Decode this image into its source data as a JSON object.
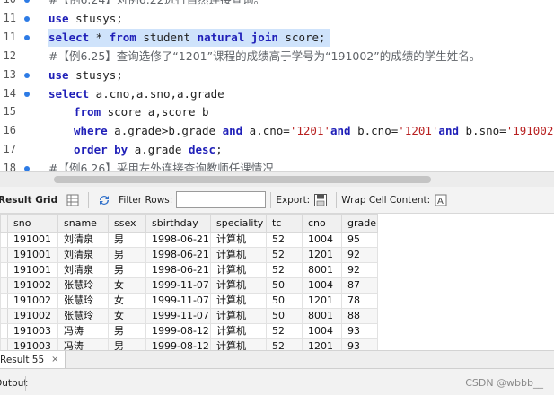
{
  "editor": {
    "lines": [
      {
        "no": "10",
        "bullet": true,
        "segments": [
          {
            "t": "#【例6.24】对例6.22进行自然连接查询。",
            "c": "cmt"
          }
        ]
      },
      {
        "no": "11",
        "bullet": true,
        "segments": [
          {
            "t": "use",
            "c": "kw"
          },
          {
            "t": " stusys;",
            "c": ""
          }
        ]
      },
      {
        "no": "11",
        "bullet": true,
        "selected": true,
        "segments": [
          {
            "t": "select",
            "c": "kw"
          },
          {
            "t": " * ",
            "c": ""
          },
          {
            "t": "from",
            "c": "kw"
          },
          {
            "t": " student ",
            "c": ""
          },
          {
            "t": "natural join",
            "c": "kw"
          },
          {
            "t": " score;",
            "c": ""
          }
        ]
      },
      {
        "no": "12",
        "bullet": false,
        "segments": [
          {
            "t": "#【例6.25】查询选修了“1201”课程的成绩高于学号为“191002”的成绩的学生姓名。",
            "c": "cmt"
          }
        ]
      },
      {
        "no": "13",
        "bullet": true,
        "segments": [
          {
            "t": "use",
            "c": "kw"
          },
          {
            "t": " stusys;",
            "c": ""
          }
        ]
      },
      {
        "no": "14",
        "bullet": true,
        "segments": [
          {
            "t": "select",
            "c": "kw"
          },
          {
            "t": " a.cno,a.sno,a.grade",
            "c": ""
          }
        ]
      },
      {
        "no": "15",
        "bullet": false,
        "indent": true,
        "segments": [
          {
            "t": "from",
            "c": "kw"
          },
          {
            "t": " score a,score b",
            "c": ""
          }
        ]
      },
      {
        "no": "16",
        "bullet": false,
        "indent": true,
        "segments": [
          {
            "t": "where",
            "c": "kw"
          },
          {
            "t": " a.grade>b.grade ",
            "c": ""
          },
          {
            "t": "and",
            "c": "kw"
          },
          {
            "t": " a.cno=",
            "c": ""
          },
          {
            "t": "'1201'",
            "c": "str"
          },
          {
            "t": "and",
            "c": "kw"
          },
          {
            "t": " b.cno=",
            "c": ""
          },
          {
            "t": "'1201'",
            "c": "str"
          },
          {
            "t": "and",
            "c": "kw"
          },
          {
            "t": " b.sno=",
            "c": ""
          },
          {
            "t": "'191002'",
            "c": "str"
          }
        ]
      },
      {
        "no": "17",
        "bullet": false,
        "indent": true,
        "segments": [
          {
            "t": "order by",
            "c": "kw"
          },
          {
            "t": " a.grade ",
            "c": ""
          },
          {
            "t": "desc",
            "c": "kw"
          },
          {
            "t": ";",
            "c": ""
          }
        ]
      },
      {
        "no": "18",
        "bullet": true,
        "segments": [
          {
            "t": "#【例6.26】采用左外连接查询教师任课情况",
            "c": "cmt"
          }
        ]
      }
    ]
  },
  "toolbar": {
    "result_grid": "Result Grid",
    "filter_rows": "Filter Rows:",
    "filter_value": "",
    "export": "Export:",
    "wrap_cell": "Wrap Cell Content:"
  },
  "grid": {
    "columns": [
      "sno",
      "sname",
      "ssex",
      "sbirthday",
      "speciality",
      "tc",
      "cno",
      "grade"
    ],
    "rows": [
      [
        "191001",
        "刘清泉",
        "男",
        "1998-06-21",
        "计算机",
        "52",
        "1004",
        "95"
      ],
      [
        "191001",
        "刘清泉",
        "男",
        "1998-06-21",
        "计算机",
        "52",
        "1201",
        "92"
      ],
      [
        "191001",
        "刘清泉",
        "男",
        "1998-06-21",
        "计算机",
        "52",
        "8001",
        "92"
      ],
      [
        "191002",
        "张慧玲",
        "女",
        "1999-11-07",
        "计算机",
        "50",
        "1004",
        "87"
      ],
      [
        "191002",
        "张慧玲",
        "女",
        "1999-11-07",
        "计算机",
        "50",
        "1201",
        "78"
      ],
      [
        "191002",
        "张慧玲",
        "女",
        "1999-11-07",
        "计算机",
        "50",
        "8001",
        "88"
      ],
      [
        "191003",
        "冯涛",
        "男",
        "1999-08-12",
        "计算机",
        "52",
        "1004",
        "93"
      ],
      [
        "191003",
        "冯涛",
        "男",
        "1999-08-12",
        "计算机",
        "52",
        "1201",
        "93"
      ]
    ]
  },
  "result_tab": {
    "label": "Result 55",
    "close": "×"
  },
  "status": {
    "output": "Output",
    "watermark": "CSDN @wbbb__"
  },
  "colors": {
    "keyword": "#1f1fb8",
    "string": "#b82020",
    "comment": "#5f6368",
    "selection": "#cfe3fb",
    "bullet": "#2d7be5"
  }
}
